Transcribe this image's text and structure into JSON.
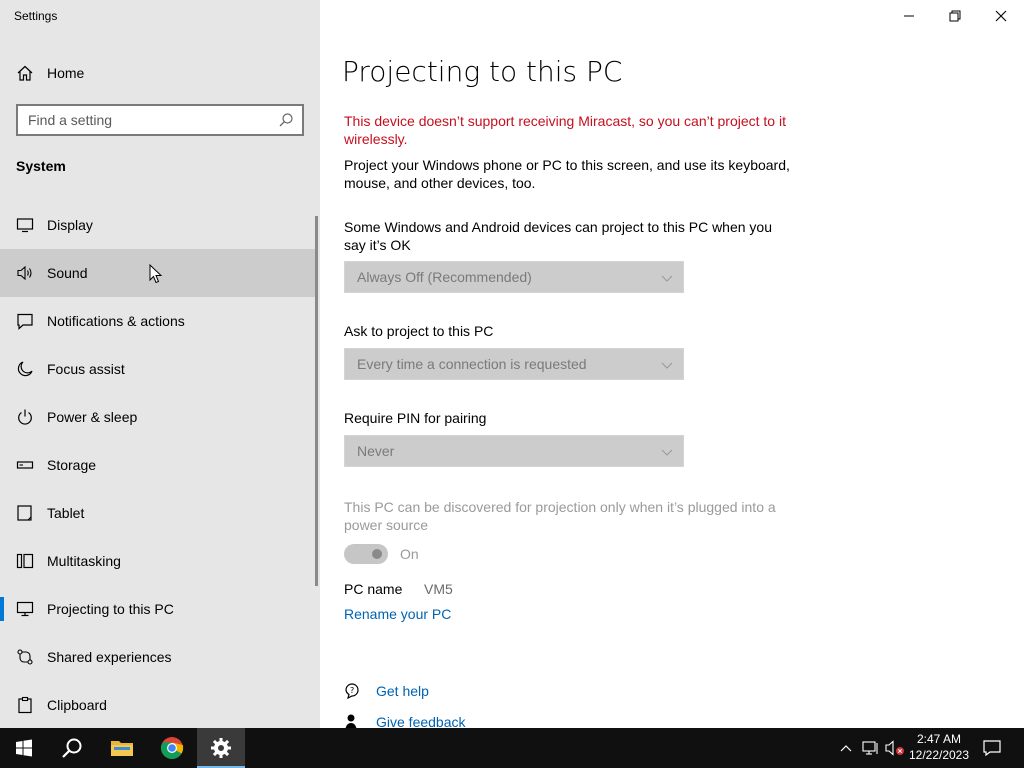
{
  "window": {
    "app_title": "Settings"
  },
  "sidebar": {
    "home_label": "Home",
    "search_placeholder": "Find a setting",
    "section_title": "System",
    "items": [
      {
        "label": "Display",
        "icon": "monitor-icon"
      },
      {
        "label": "Sound",
        "icon": "speaker-icon"
      },
      {
        "label": "Notifications & actions",
        "icon": "notification-icon"
      },
      {
        "label": "Focus assist",
        "icon": "moon-icon"
      },
      {
        "label": "Power & sleep",
        "icon": "power-icon"
      },
      {
        "label": "Storage",
        "icon": "storage-icon"
      },
      {
        "label": "Tablet",
        "icon": "tablet-icon"
      },
      {
        "label": "Multitasking",
        "icon": "multitasking-icon"
      },
      {
        "label": "Projecting to this PC",
        "icon": "project-icon"
      },
      {
        "label": "Shared experiences",
        "icon": "shared-icon"
      },
      {
        "label": "Clipboard",
        "icon": "clipboard-icon"
      }
    ],
    "hovered_item": "Sound",
    "selected_item": "Projecting to this PC"
  },
  "main": {
    "title": "Projecting to this PC",
    "warning": "This device doesn’t support receiving Miracast, so you can’t project to it wirelessly.",
    "intro": "Project your Windows phone or PC to this screen, and use its keyboard, mouse, and other devices, too.",
    "setting1_label": "Some Windows and Android devices can project to this PC when you say it’s OK",
    "setting1_value": "Always Off (Recommended)",
    "setting2_label": "Ask to project to this PC",
    "setting2_value": "Every time a connection is requested",
    "setting3_label": "Require PIN for pairing",
    "setting3_value": "Never",
    "plugged_text": "This PC can be discovered for projection only when it’s plugged into a power source",
    "toggle_label": "On",
    "pc_name_label": "PC name",
    "pc_name_value": "VM5",
    "rename_link": "Rename your PC",
    "get_help": "Get help",
    "give_feedback": "Give feedback"
  },
  "taskbar": {
    "time": "2:47 AM",
    "date": "12/22/2023",
    "accent": "#0078d7"
  }
}
